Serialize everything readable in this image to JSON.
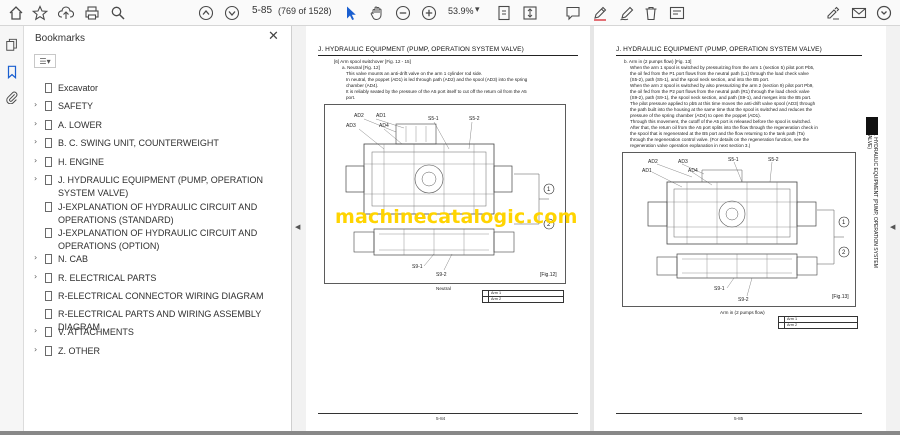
{
  "toolbar": {
    "page_current": "5-85",
    "page_count": "(769 of 1528)",
    "zoom": "53.9%"
  },
  "panel": {
    "title": "Bookmarks",
    "items": [
      {
        "label": "Excavator",
        "expandable": false
      },
      {
        "label": "SAFETY",
        "expandable": true
      },
      {
        "label": "A. LOWER",
        "expandable": true
      },
      {
        "label": "B. C. SWING UNIT, COUNTERWEIGHT",
        "expandable": true
      },
      {
        "label": "H. ENGINE",
        "expandable": true
      },
      {
        "label": "J. HYDRAULIC EQUIPMENT (PUMP, OPERATION SYSTEM VALVE)",
        "expandable": true
      },
      {
        "label": "J-EXPLANATION OF HYDRAULIC CIRCUIT AND OPERATIONS (STANDARD)",
        "expandable": false
      },
      {
        "label": "J-EXPLANATION OF HYDRAULIC CIRCUIT AND OPERATIONS (OPTION)",
        "expandable": false
      },
      {
        "label": "N. CAB",
        "expandable": true
      },
      {
        "label": "R. ELECTRICAL PARTS",
        "expandable": true
      },
      {
        "label": "R-ELECTRICAL CONNECTOR WIRING DIAGRAM",
        "expandable": false
      },
      {
        "label": "R-ELECTRICAL PARTS AND WIRING ASSEMBLY DIAGRAM",
        "expandable": false
      },
      {
        "label": "V. ATTACHMENTS",
        "expandable": true
      },
      {
        "label": "Z. OTHER",
        "expandable": true
      }
    ]
  },
  "left_page": {
    "header": "J. HYDRAULIC EQUIPMENT (PUMP, OPERATION SYSTEM VALVE)",
    "lines": [
      "[6] Arm spool switchover [Fig. 12 - 15]",
      "a. Neutral [Fig. 12]",
      "This valve mounts an anti-drift valve on the arm 1 cylinder rod side.",
      "In neutral, the poppet (AD1) is led through path (AD2) and the spool (AD3) into the spring",
      "chamber (AD4).",
      "It is reliably seated by the pressure of the A5 port itself to cut off the return oil from the A5",
      "port."
    ],
    "fig_label": "[Fig.12]",
    "caption": "Neutral",
    "legend": [
      "Arm 1",
      "Arm 2"
    ],
    "page_number": "5-84",
    "callouts": [
      "AD2",
      "AD1",
      "AD3",
      "AD4",
      "S5-1",
      "S5-2",
      "S9-1",
      "S9-2",
      "1",
      "2"
    ]
  },
  "right_page": {
    "header": "J. HYDRAULIC EQUIPMENT (PUMP, OPERATION SYSTEM VALVE)",
    "lines": [
      "b. Arm in (2 pumps flow) [Fig. 13]",
      "When the arm 1 spool is switched by pressurizing from the arm 1 (section 5) pilot port Pb5,",
      "the oil fed from the P1 port flows from the neutral path (L1) through the load check valve",
      "(S5-2), path (S5-1), and the spool neck section, and into the B5 port.",
      "When the arm 2 spool is switched by also pressurizing the arm 2 (section 9) pilot port Pb9,",
      "the oil fed from the P2 port flows from the neutral path (R1) through the load check valve",
      "(S9-2), path (S9-1), the spool neck section, and path (S9-1), and merges into the B5 port.",
      "The pilot pressure applied to pb5 at this time moves the anti-drift valve spool (AD3) through",
      "the path built into the housing at the same time that the spool is switched and reduces the",
      "pressure of the spring chamber (AD4) to open the poppet (AD1).",
      "Through this movement, the cutoff of the A5 port is released before the spool is switched.",
      "After that, the return oil from the A5 port splits into the flow through the regeneration check in",
      "the spool that is regenerated at the B5 port and the flow returning to the tank path (Ta)",
      "through the regeneration control valve. (For details on the regeneration function, see the",
      "regeneration valve operation explanation in next section 3.)"
    ],
    "fig_label": "[Fig.13]",
    "caption": "Arm in (2 pumps flow)",
    "legend": [
      "Arm 1",
      "Arm 2"
    ],
    "page_number": "5-85",
    "side_text": "J. HYDRAULIC EQUIPMENT (PUMP, OPERATION SYSTEM VALVE)",
    "callouts": [
      "AD2",
      "AD3",
      "AD1",
      "AD4",
      "S5-1",
      "S5-2",
      "S9-1",
      "S9-2",
      "1",
      "2"
    ]
  },
  "watermark": "machinecatalogic.com"
}
